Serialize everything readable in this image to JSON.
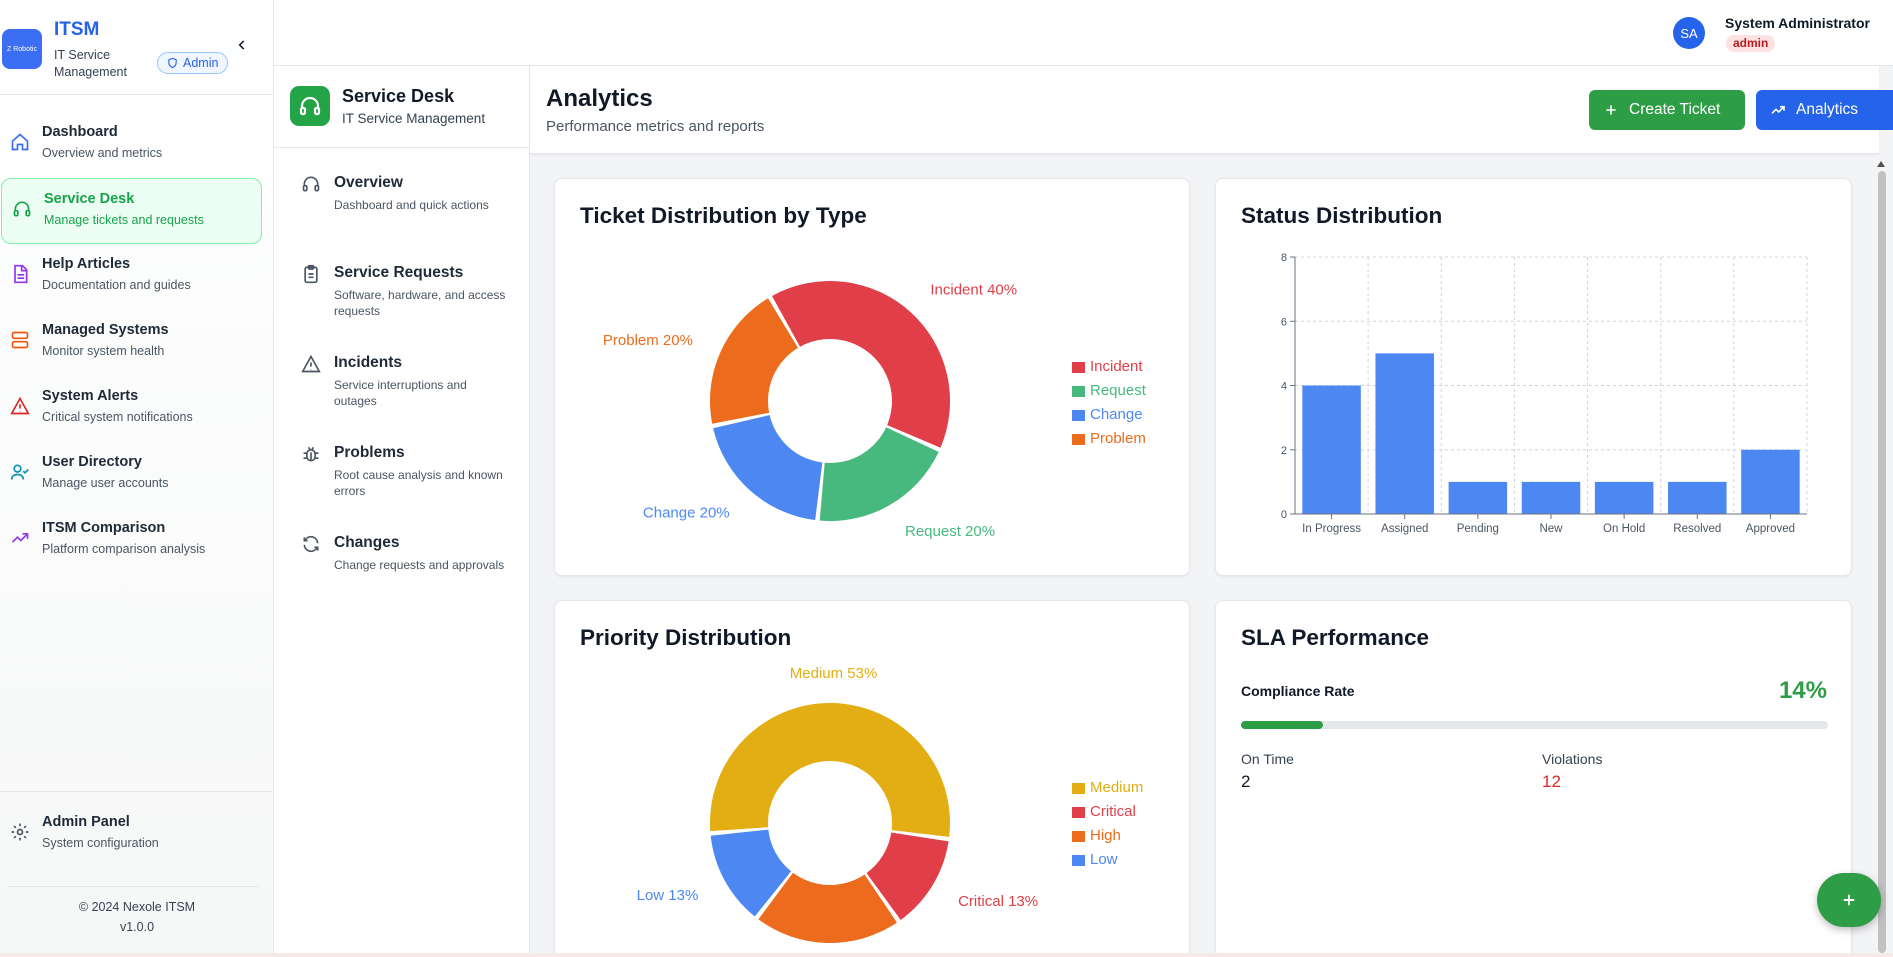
{
  "sidebar": {
    "logo_text": "Z Robotic",
    "brand": "ITSM",
    "brand_sub": "IT Service Management",
    "role_badge": "Admin",
    "items": [
      {
        "title": "Dashboard",
        "desc": "Overview and metrics",
        "icon": "home-icon"
      },
      {
        "title": "Service Desk",
        "desc": "Manage tickets and requests",
        "icon": "headset-icon"
      },
      {
        "title": "Help Articles",
        "desc": "Documentation and guides",
        "icon": "document-icon"
      },
      {
        "title": "Managed Systems",
        "desc": "Monitor system health",
        "icon": "server-icon"
      },
      {
        "title": "System Alerts",
        "desc": "Critical system notifications",
        "icon": "alert-triangle-icon"
      },
      {
        "title": "User Directory",
        "desc": "Manage user accounts",
        "icon": "users-icon"
      },
      {
        "title": "ITSM Comparison",
        "desc": "Platform comparison analysis",
        "icon": "trending-up-icon"
      }
    ],
    "admin_panel": {
      "title": "Admin Panel",
      "desc": "System configuration",
      "icon": "gear-icon"
    },
    "footer": {
      "copyright": "© 2024 Nexole ITSM",
      "version": "v1.0.0"
    }
  },
  "header": {
    "avatar_initials": "SA",
    "user_name": "System Administrator",
    "user_role": "admin"
  },
  "subnav": {
    "title": "Service Desk",
    "subtitle": "IT Service Management",
    "items": [
      {
        "title": "Overview",
        "desc": "Dashboard and quick actions",
        "icon": "headset-icon"
      },
      {
        "title": "Service Requests",
        "desc": "Software, hardware, and access requests",
        "icon": "clipboard-icon"
      },
      {
        "title": "Incidents",
        "desc": "Service interruptions and outages",
        "icon": "warning-icon"
      },
      {
        "title": "Problems",
        "desc": "Root cause analysis and known errors",
        "icon": "bug-icon"
      },
      {
        "title": "Changes",
        "desc": "Change requests and approvals",
        "icon": "refresh-icon"
      }
    ]
  },
  "page": {
    "title": "Analytics",
    "subtitle": "Performance metrics and reports",
    "create_label": "Create Ticket",
    "analytics_label": "Analytics"
  },
  "colors": {
    "red": "#e03e48",
    "green": "#47b97e",
    "blue": "#4d88f2",
    "orange": "#ec6b1c",
    "yellow": "#e2ae14",
    "bar": "#4d88f2",
    "accent_green": "#2e9e46",
    "accent_blue": "#2563eb"
  },
  "sla": {
    "title": "SLA Performance",
    "compliance_label": "Compliance Rate",
    "compliance_value": "14%",
    "compliance_fraction": 0.14,
    "on_time_label": "On Time",
    "on_time_value": "2",
    "violations_label": "Violations",
    "violations_value": "12"
  },
  "chart_data": [
    {
      "type": "pie",
      "title": "Ticket Distribution by Type",
      "labels": [
        "Incident",
        "Request",
        "Change",
        "Problem"
      ],
      "values": [
        40,
        20,
        20,
        20
      ],
      "data_labels": [
        "Incident 40%",
        "Request 20%",
        "Change 20%",
        "Problem 20%"
      ],
      "donut": true,
      "legend": "right"
    },
    {
      "type": "bar",
      "title": "Status Distribution",
      "categories": [
        "In Progress",
        "Assigned",
        "Pending",
        "New",
        "On Hold",
        "Resolved",
        "Approved"
      ],
      "values": [
        4,
        5,
        1,
        1,
        1,
        1,
        2
      ],
      "ylim": [
        0,
        8
      ],
      "yticks": [
        0,
        2,
        4,
        6,
        8
      ],
      "grid": true
    },
    {
      "type": "pie",
      "title": "Priority Distribution",
      "labels": [
        "Medium",
        "Critical",
        "High",
        "Low"
      ],
      "values": [
        53,
        13,
        20,
        13
      ],
      "data_labels": [
        "Medium 53%",
        "Critical 13%",
        "",
        "Low 13%"
      ],
      "donut": true,
      "legend": "right"
    }
  ]
}
